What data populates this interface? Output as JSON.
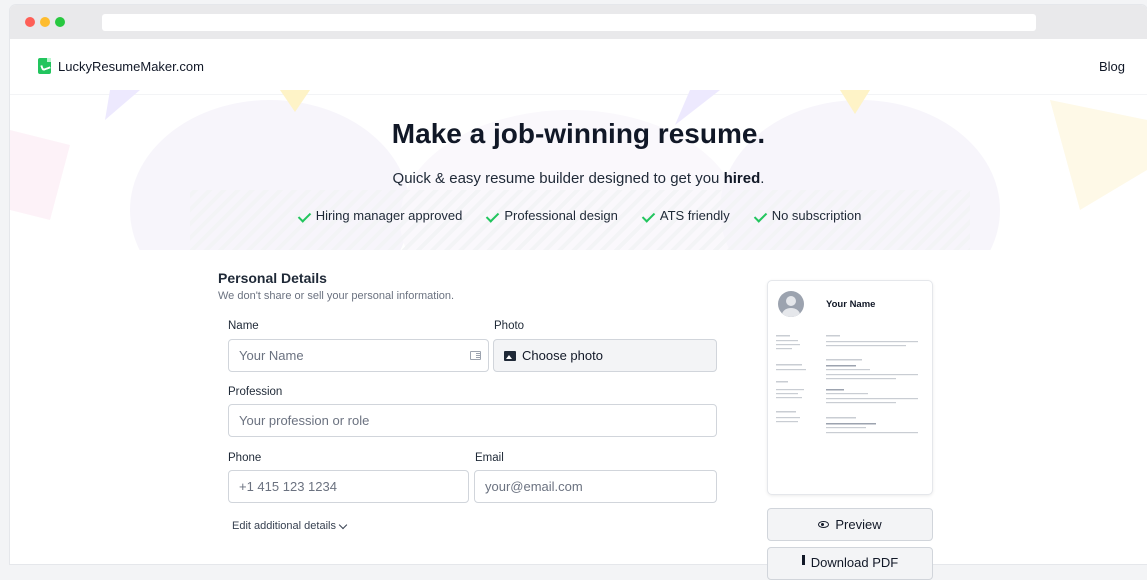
{
  "nav": {
    "brand": "LuckyResumeMaker.com",
    "blog": "Blog"
  },
  "hero": {
    "title": "Make a job-winning resume.",
    "subtitle_pre": "Quick & easy resume builder designed to get you ",
    "subtitle_bold": "hired",
    "subtitle_post": ".",
    "features": [
      "Hiring manager approved",
      "Professional design",
      "ATS friendly",
      "No subscription"
    ]
  },
  "form": {
    "section_title": "Personal Details",
    "section_hint": "We don't share or sell your personal information.",
    "name_label": "Name",
    "name_placeholder": "Your Name",
    "photo_label": "Photo",
    "photo_button": "Choose photo",
    "profession_label": "Profession",
    "profession_placeholder": "Your profession or role",
    "phone_label": "Phone",
    "phone_placeholder": "+1 415 123 1234",
    "email_label": "Email",
    "email_placeholder": "your@email.com",
    "edit_more": "Edit additional details"
  },
  "preview": {
    "name": "Your Name",
    "preview_button": "Preview",
    "download_button": "Download PDF"
  },
  "colors": {
    "accent": "#22c55e",
    "text": "#111827"
  }
}
